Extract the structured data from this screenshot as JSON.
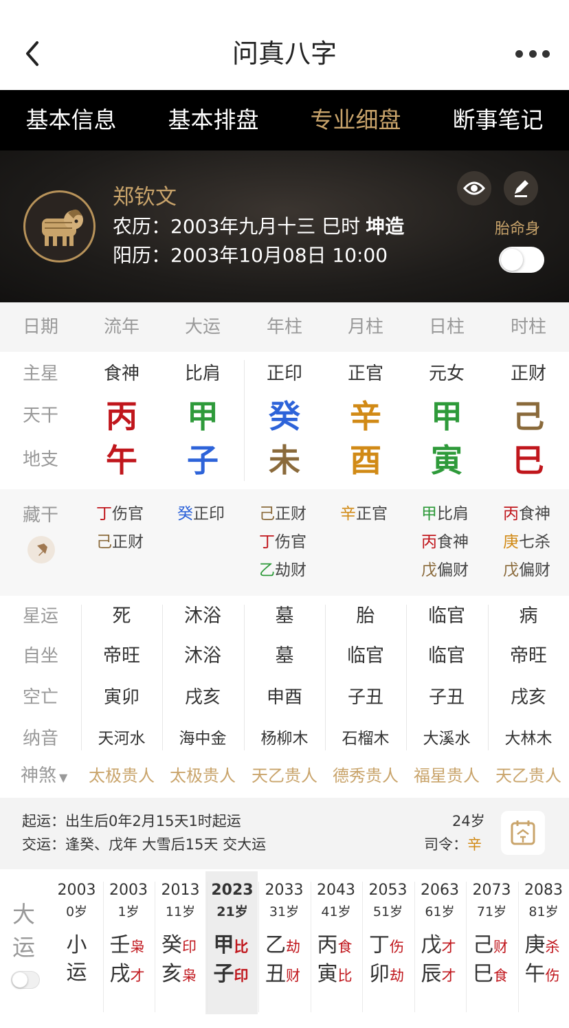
{
  "header": {
    "title": "问真八字"
  },
  "tabs": [
    {
      "label": "基本信息",
      "active": false
    },
    {
      "label": "基本排盘",
      "active": false
    },
    {
      "label": "专业细盘",
      "active": true
    },
    {
      "label": "断事笔记",
      "active": false
    }
  ],
  "profile": {
    "name": "郑钦文",
    "lunar_prefix": "农历：",
    "lunar_date": "2003年九月十三 巳时",
    "gender_tag": "坤造",
    "solar_prefix": "阳历：",
    "solar_date": "2003年10月08日 10:00",
    "taimingshen_label": "胎命身",
    "taimingshen_on": false
  },
  "columns": [
    "日期",
    "流年",
    "大运",
    "年柱",
    "月柱",
    "日柱",
    "时柱"
  ],
  "zhuxing": {
    "label": "主星",
    "values": [
      "食神",
      "比肩",
      "正印",
      "正官",
      "元女",
      "正财"
    ]
  },
  "tiangan": {
    "label": "天干",
    "values": [
      "丙",
      "甲",
      "癸",
      "辛",
      "甲",
      "己"
    ],
    "colors": [
      "#c0161c",
      "#2e9a3a",
      "#2d63d9",
      "#d18a16",
      "#2e9a3a",
      "#8a6a3b"
    ]
  },
  "dizhi": {
    "label": "地支",
    "values": [
      "午",
      "子",
      "未",
      "酉",
      "寅",
      "巳"
    ],
    "colors": [
      "#c0161c",
      "#2d63d9",
      "#8a6a3b",
      "#d18a16",
      "#2e9a3a",
      "#c0161c"
    ]
  },
  "canggan": {
    "label": "藏干",
    "cols": [
      [
        {
          "g": "丁",
          "t": "伤官",
          "c": "#c0161c"
        },
        {
          "g": "己",
          "t": "正财",
          "c": "#8a6a3b"
        }
      ],
      [
        {
          "g": "癸",
          "t": "正印",
          "c": "#2d63d9"
        }
      ],
      [
        {
          "g": "己",
          "t": "正财",
          "c": "#8a6a3b"
        },
        {
          "g": "丁",
          "t": "伤官",
          "c": "#c0161c"
        },
        {
          "g": "乙",
          "t": "劫财",
          "c": "#2e9a3a"
        }
      ],
      [
        {
          "g": "辛",
          "t": "正官",
          "c": "#d18a16"
        }
      ],
      [
        {
          "g": "甲",
          "t": "比肩",
          "c": "#2e9a3a"
        },
        {
          "g": "丙",
          "t": "食神",
          "c": "#c0161c"
        },
        {
          "g": "戊",
          "t": "偏财",
          "c": "#8a6a3b"
        }
      ],
      [
        {
          "g": "丙",
          "t": "食神",
          "c": "#c0161c"
        },
        {
          "g": "庚",
          "t": "七杀",
          "c": "#d18a16"
        },
        {
          "g": "戊",
          "t": "偏财",
          "c": "#8a6a3b"
        }
      ]
    ]
  },
  "xingyun": {
    "label": "星运",
    "values": [
      "死",
      "沐浴",
      "墓",
      "胎",
      "临官",
      "病"
    ]
  },
  "zizuo": {
    "label": "自坐",
    "values": [
      "帝旺",
      "沐浴",
      "墓",
      "临官",
      "临官",
      "帝旺"
    ]
  },
  "kongwang": {
    "label": "空亡",
    "values": [
      "寅卯",
      "戌亥",
      "申酉",
      "子丑",
      "子丑",
      "戌亥"
    ]
  },
  "nayin": {
    "label": "纳音",
    "values": [
      "天河水",
      "海中金",
      "杨柳木",
      "石榴木",
      "大溪水",
      "大林木"
    ]
  },
  "shensha": {
    "label": "神煞",
    "values": [
      "太极贵人",
      "太极贵人",
      "天乙贵人",
      "德秀贵人",
      "福星贵人",
      "天乙贵人"
    ]
  },
  "qiyun": {
    "line1": "起运：出生后0年2月15天1时起运",
    "line2": "交运：逢癸、戊年 大雪后15天 交大运",
    "age": "24岁",
    "siling_label": "司令：",
    "siling_value": "辛"
  },
  "dayun": {
    "label_top": "大",
    "label_bottom": "运",
    "toggle_on": false,
    "items": [
      {
        "year": "2003",
        "age": "0岁",
        "g1": "小",
        "t1": "",
        "g2": "运",
        "t2": "",
        "current": false
      },
      {
        "year": "2003",
        "age": "1岁",
        "g1": "壬",
        "t1": "枭",
        "g2": "戌",
        "t2": "才",
        "current": false
      },
      {
        "year": "2013",
        "age": "11岁",
        "g1": "癸",
        "t1": "印",
        "g2": "亥",
        "t2": "枭",
        "current": false
      },
      {
        "year": "2023",
        "age": "21岁",
        "g1": "甲",
        "t1": "比",
        "g2": "子",
        "t2": "印",
        "current": true
      },
      {
        "year": "2033",
        "age": "31岁",
        "g1": "乙",
        "t1": "劫",
        "g2": "丑",
        "t2": "财",
        "current": false
      },
      {
        "year": "2043",
        "age": "41岁",
        "g1": "丙",
        "t1": "食",
        "g2": "寅",
        "t2": "比",
        "current": false
      },
      {
        "year": "2053",
        "age": "51岁",
        "g1": "丁",
        "t1": "伤",
        "g2": "卯",
        "t2": "劫",
        "current": false
      },
      {
        "year": "2063",
        "age": "61岁",
        "g1": "戊",
        "t1": "才",
        "g2": "辰",
        "t2": "才",
        "current": false
      },
      {
        "year": "2073",
        "age": "71岁",
        "g1": "己",
        "t1": "财",
        "g2": "巳",
        "t2": "食",
        "current": false
      },
      {
        "year": "2083",
        "age": "81岁",
        "g1": "庚",
        "t1": "杀",
        "g2": "午",
        "t2": "伤",
        "current": false
      }
    ]
  }
}
